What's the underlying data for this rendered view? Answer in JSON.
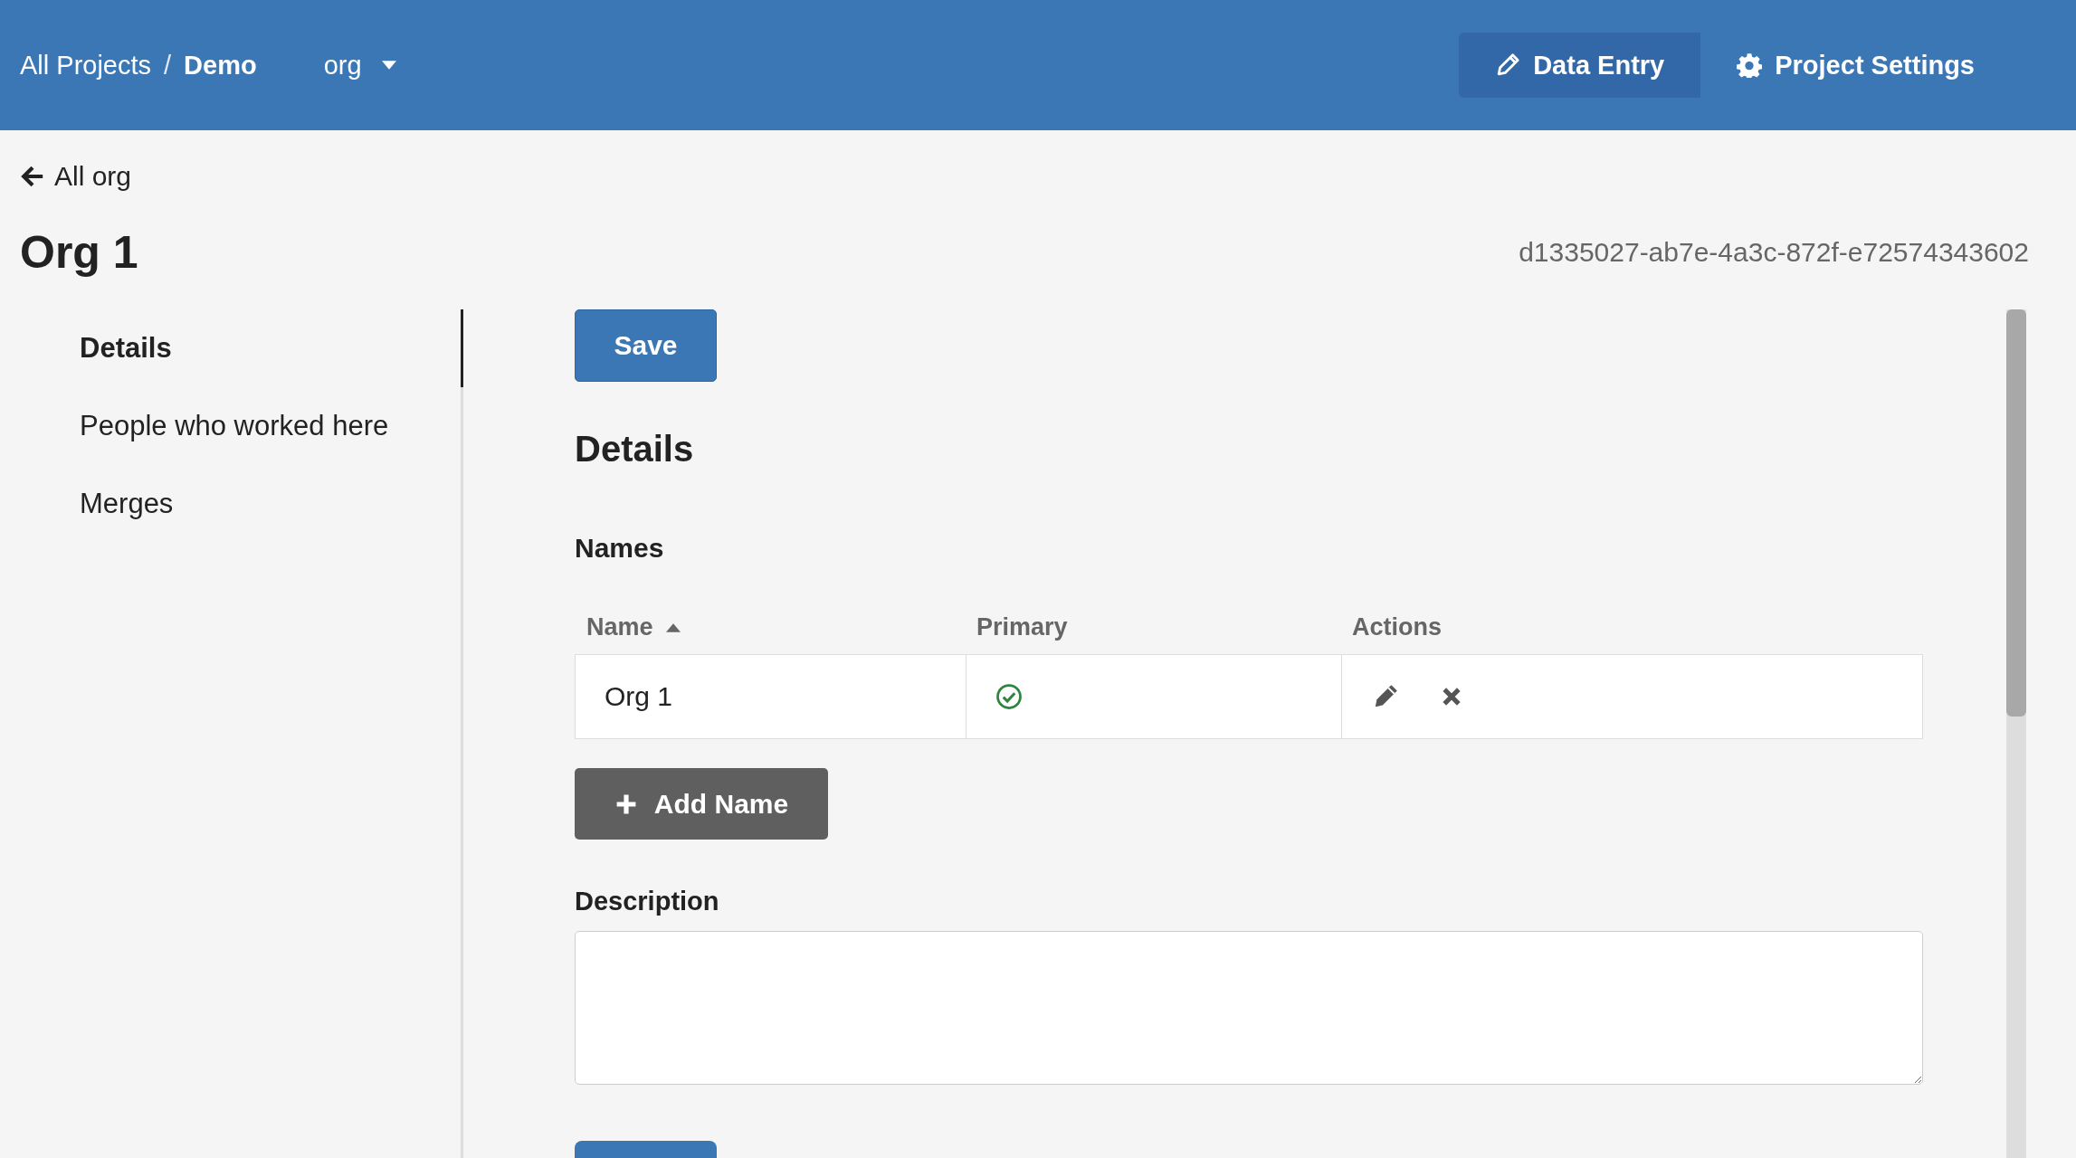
{
  "header": {
    "breadcrumb": [
      {
        "label": "All Projects",
        "current": false
      },
      {
        "label": "Demo",
        "current": true
      }
    ],
    "separator": "/",
    "type_menu": "org",
    "nav": [
      {
        "label": "Data Entry",
        "kind": "pencil",
        "selected": true
      },
      {
        "label": "Project Settings",
        "kind": "gear",
        "selected": false
      }
    ]
  },
  "back_link": "All org",
  "title": "Org 1",
  "record_id": "d1335027-ab7e-4a3c-872f-e72574343602",
  "sidebar": {
    "items": [
      {
        "label": "Details",
        "selected": true
      },
      {
        "label": "People who worked here",
        "selected": false
      },
      {
        "label": "Merges",
        "selected": false
      }
    ]
  },
  "save_button": "Save",
  "section_title": "Details",
  "names": {
    "title": "Names",
    "columns": [
      {
        "label": "Name",
        "sorted": true
      },
      {
        "label": "Primary",
        "sorted": false
      },
      {
        "label": "Actions",
        "sorted": false
      }
    ],
    "rows": [
      {
        "name": "Org 1",
        "primary": true
      }
    ],
    "add_button": "Add Name"
  },
  "description": {
    "label": "Description"
  }
}
